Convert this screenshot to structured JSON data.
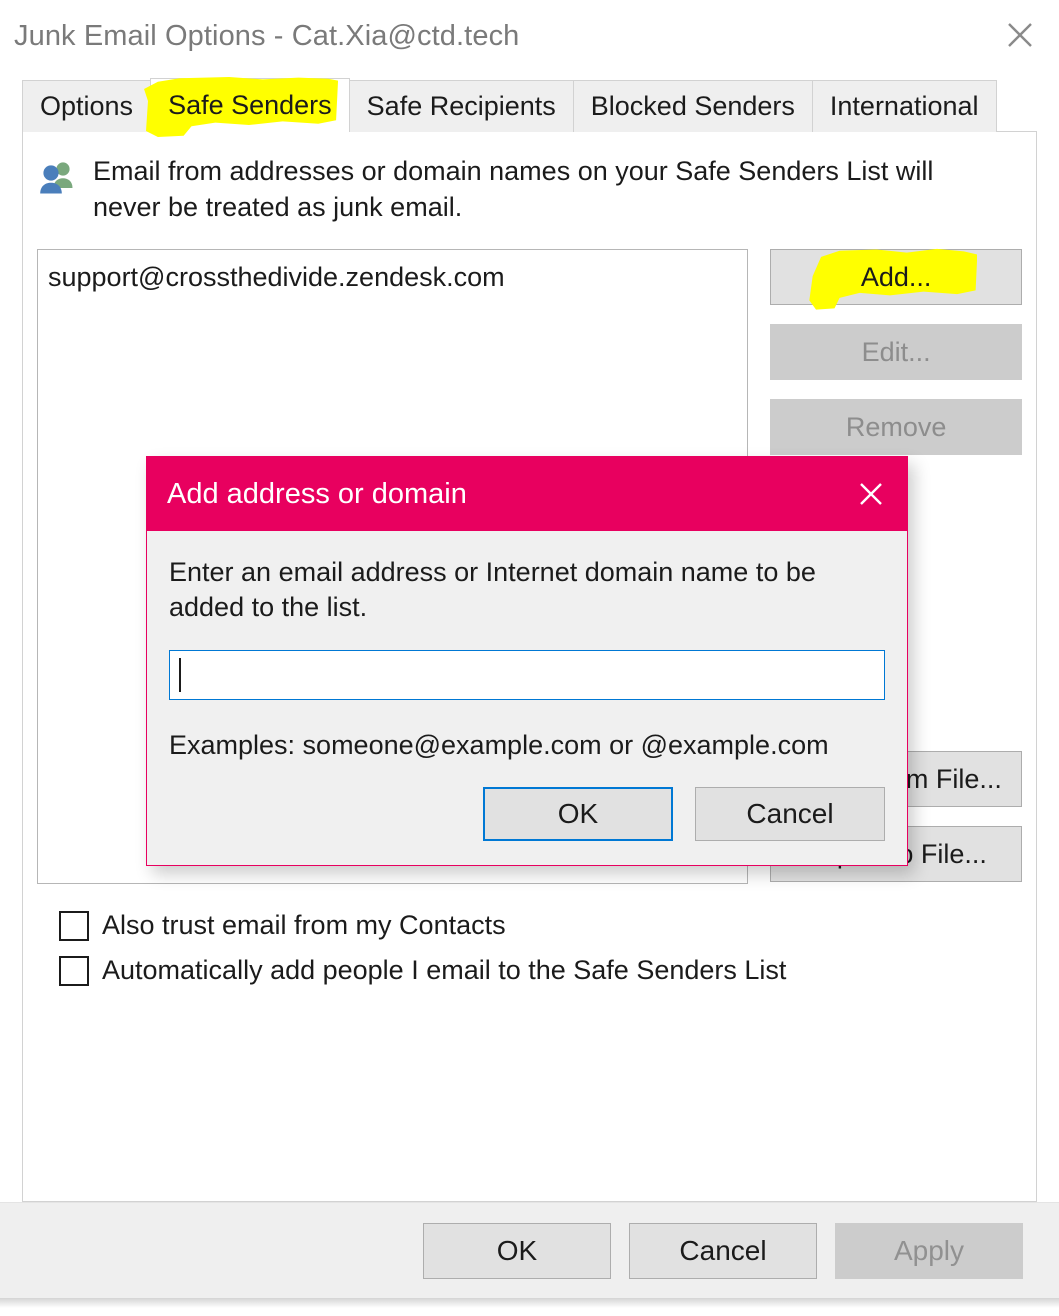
{
  "window": {
    "title": "Junk Email Options - Cat.Xia@ctd.tech",
    "close_icon": "close-icon"
  },
  "tabs": [
    {
      "label": "Options",
      "selected": false
    },
    {
      "label": "Safe Senders",
      "selected": true,
      "highlighted": true
    },
    {
      "label": "Safe Recipients",
      "selected": false
    },
    {
      "label": "Blocked Senders",
      "selected": false
    },
    {
      "label": "International",
      "selected": false
    }
  ],
  "panel": {
    "icon": "people-icon",
    "description": "Email from addresses or domain names on your Safe Senders List will never be treated as junk email.",
    "list": {
      "items": [
        "support@crossthedivide.zendesk.com"
      ]
    },
    "side_buttons": [
      {
        "label": "Add...",
        "enabled": true,
        "highlighted": true
      },
      {
        "label": "Edit...",
        "enabled": false
      },
      {
        "label": "Remove",
        "enabled": false
      },
      {
        "label": "Import from File...",
        "enabled": true
      },
      {
        "label": "Export to File...",
        "enabled": true
      }
    ],
    "checkboxes": [
      {
        "label": "Also trust email from my Contacts",
        "checked": false
      },
      {
        "label": "Automatically add people I email to the Safe Senders List",
        "checked": false
      }
    ]
  },
  "footer": {
    "ok": "OK",
    "cancel": "Cancel",
    "apply": "Apply",
    "apply_enabled": false
  },
  "modal": {
    "title": "Add address or domain",
    "close_icon": "close-icon",
    "prompt": "Enter an email address or Internet domain name to be added to the list.",
    "input_value": "",
    "input_placeholder": "",
    "examples": "Examples: someone@example.com or @example.com",
    "ok": "OK",
    "cancel": "Cancel"
  },
  "colors": {
    "modal_accent": "#e8005f",
    "highlighter": "#ffff00",
    "focus_blue": "#0078d4",
    "title_gray": "#7a7a7a"
  }
}
